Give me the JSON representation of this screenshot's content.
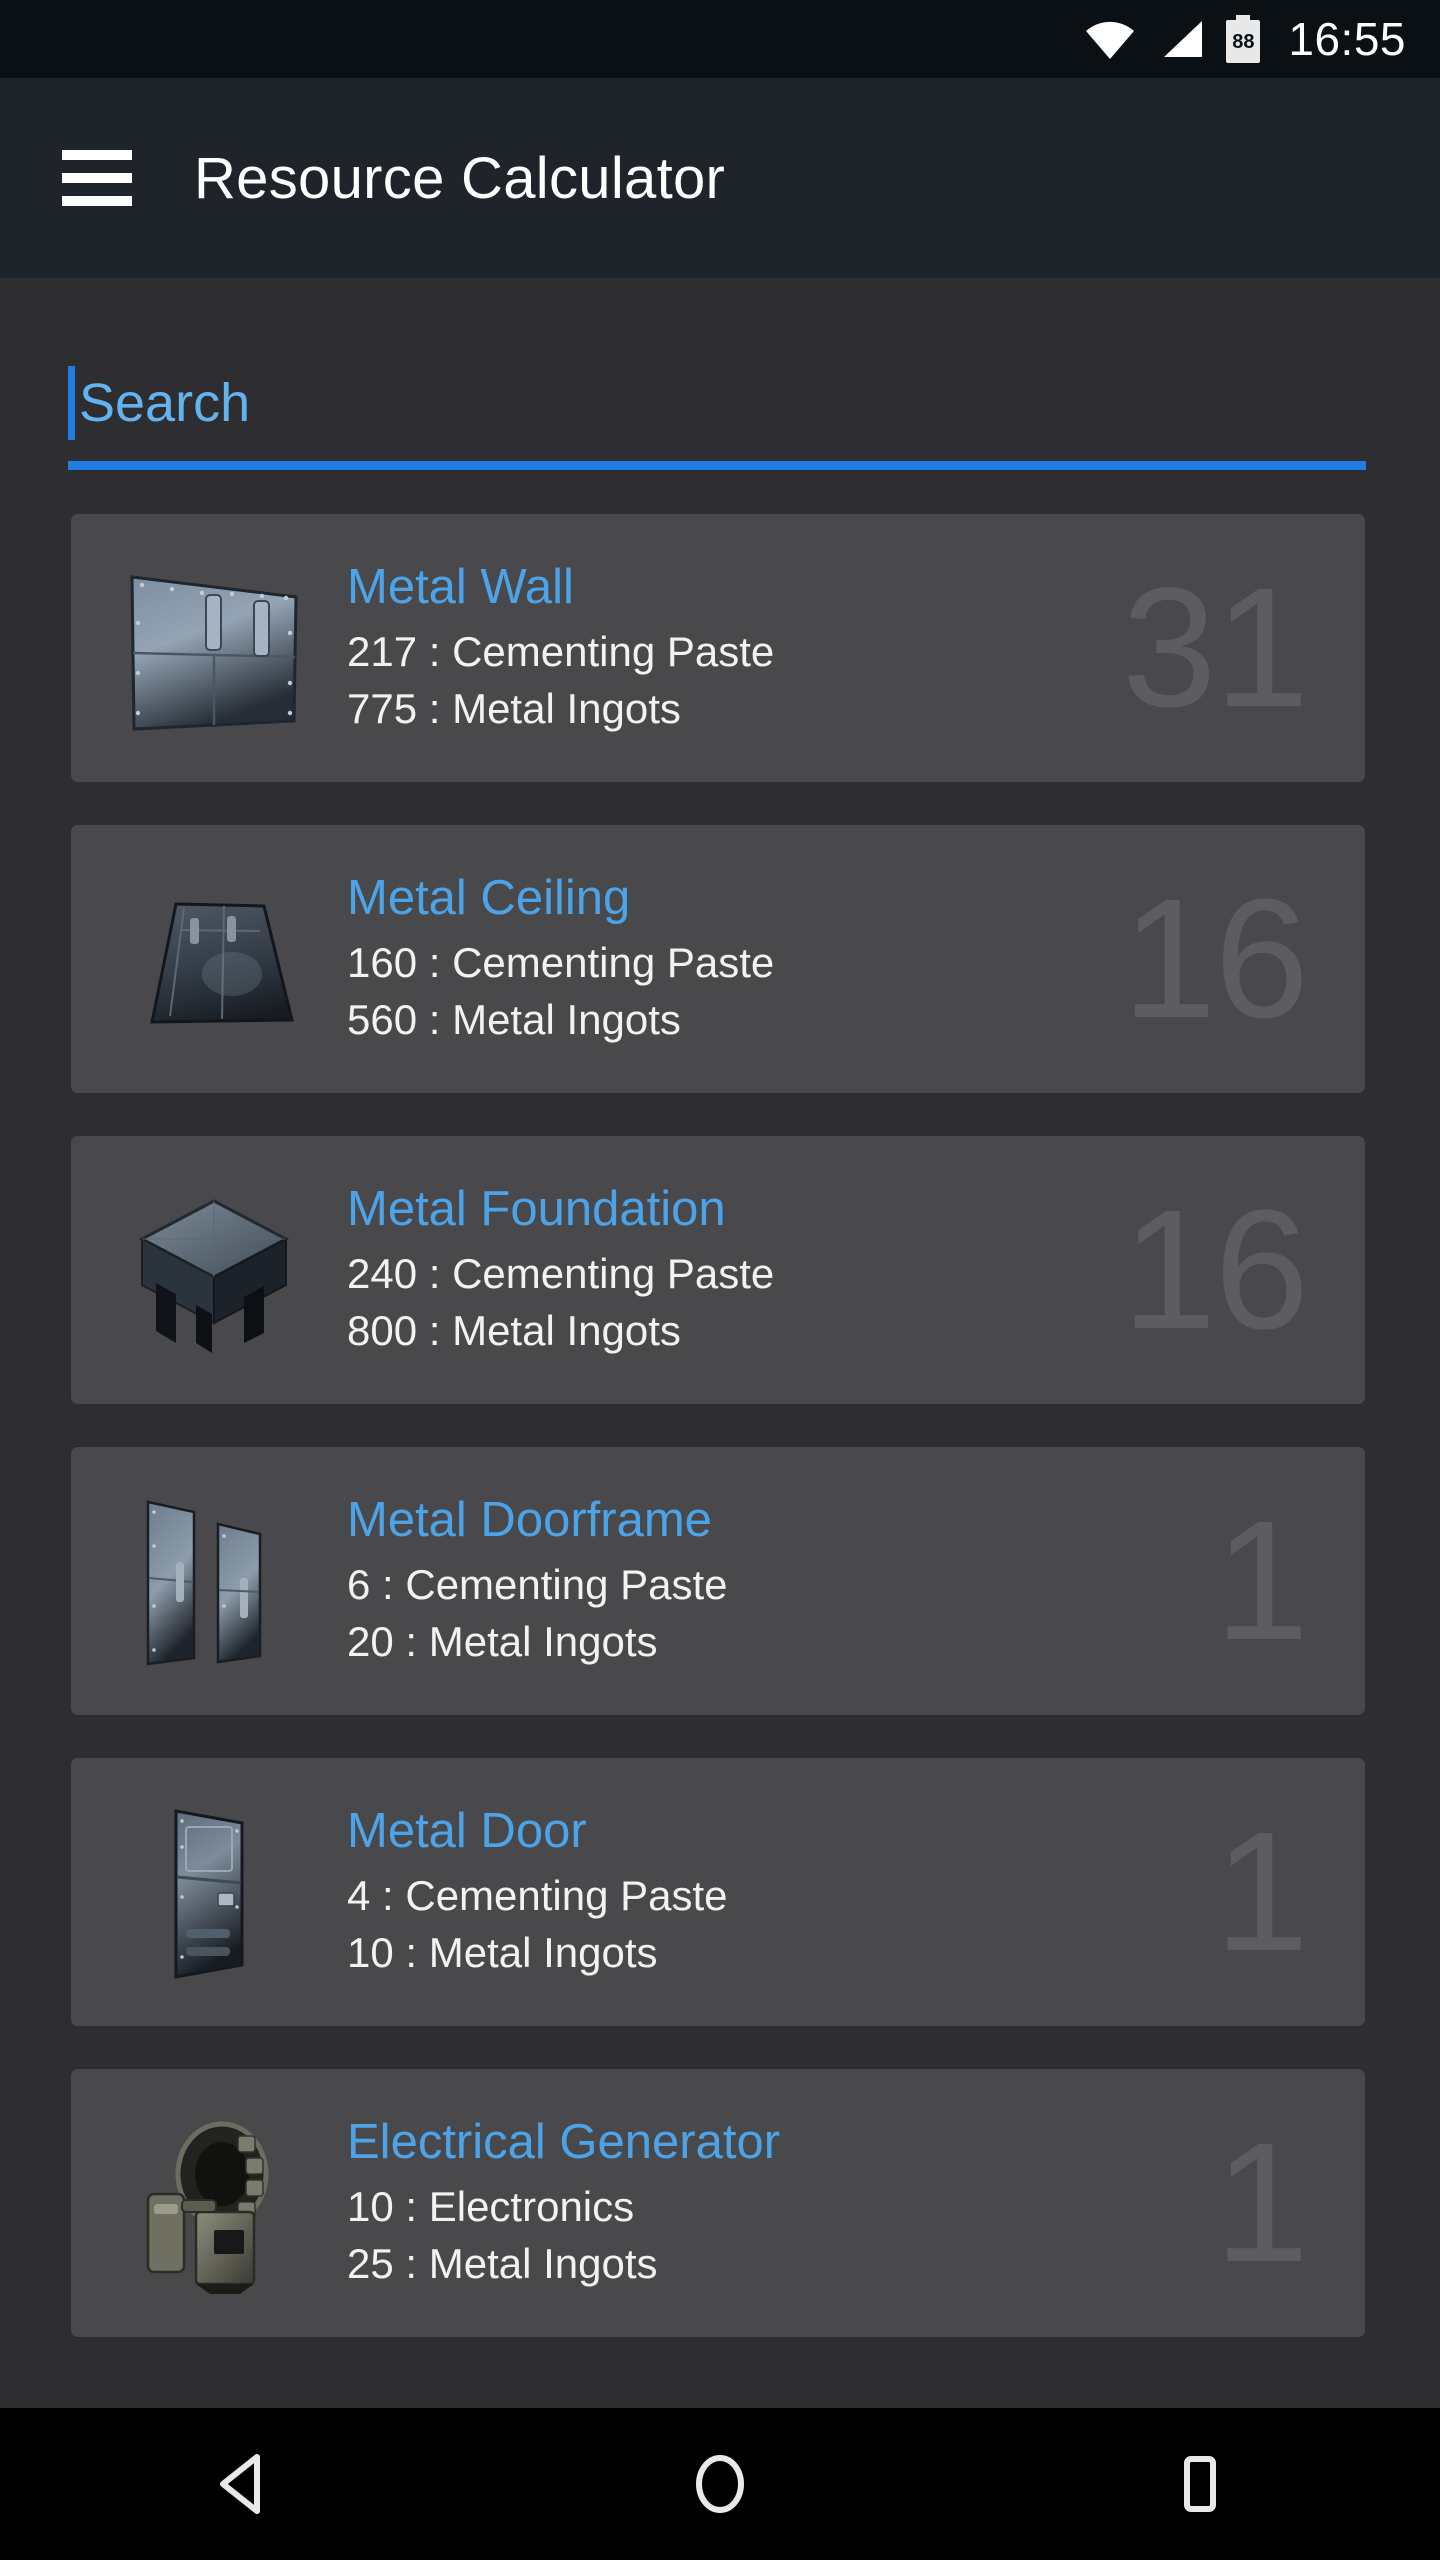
{
  "status_bar": {
    "wifi_icon": "wifi-icon",
    "signal_icon": "cell-signal-icon",
    "battery_icon": "battery-icon",
    "battery_level": "88",
    "time": "16:55"
  },
  "app_bar": {
    "menu_icon": "hamburger-menu-icon",
    "title": "Resource Calculator"
  },
  "search": {
    "value": "",
    "placeholder": "Search"
  },
  "colors": {
    "accent_blue": "#1f7ee0",
    "title_blue": "#4da3e8",
    "placeholder_blue": "#63b3f0",
    "card_background": "#49494c",
    "page_background": "#2e2e30",
    "app_bar": "#1e2429",
    "status_bar": "#0b1014",
    "quantity_gray": "#5d5d60"
  },
  "items": [
    {
      "icon": "metal-wall-icon",
      "name": "Metal Wall",
      "resources": [
        "217 : Cementing Paste",
        "775 : Metal Ingots"
      ],
      "quantity": "31"
    },
    {
      "icon": "metal-ceiling-icon",
      "name": "Metal Ceiling",
      "resources": [
        "160 : Cementing Paste",
        "560 : Metal Ingots"
      ],
      "quantity": "16"
    },
    {
      "icon": "metal-foundation-icon",
      "name": "Metal Foundation",
      "resources": [
        "240 : Cementing Paste",
        "800 : Metal Ingots"
      ],
      "quantity": "16"
    },
    {
      "icon": "metal-doorframe-icon",
      "name": "Metal Doorframe",
      "resources": [
        "6 : Cementing Paste",
        "20 : Metal Ingots"
      ],
      "quantity": "1"
    },
    {
      "icon": "metal-door-icon",
      "name": "Metal Door",
      "resources": [
        "4 : Cementing Paste",
        "10 : Metal Ingots"
      ],
      "quantity": "1"
    },
    {
      "icon": "electrical-generator-icon",
      "name": "Electrical Generator",
      "resources": [
        "10 : Electronics",
        "25 : Metal Ingots"
      ],
      "quantity": "1"
    }
  ],
  "nav_bar": {
    "back": "back-triangle-icon",
    "home": "home-circle-icon",
    "recents": "recents-square-icon"
  }
}
